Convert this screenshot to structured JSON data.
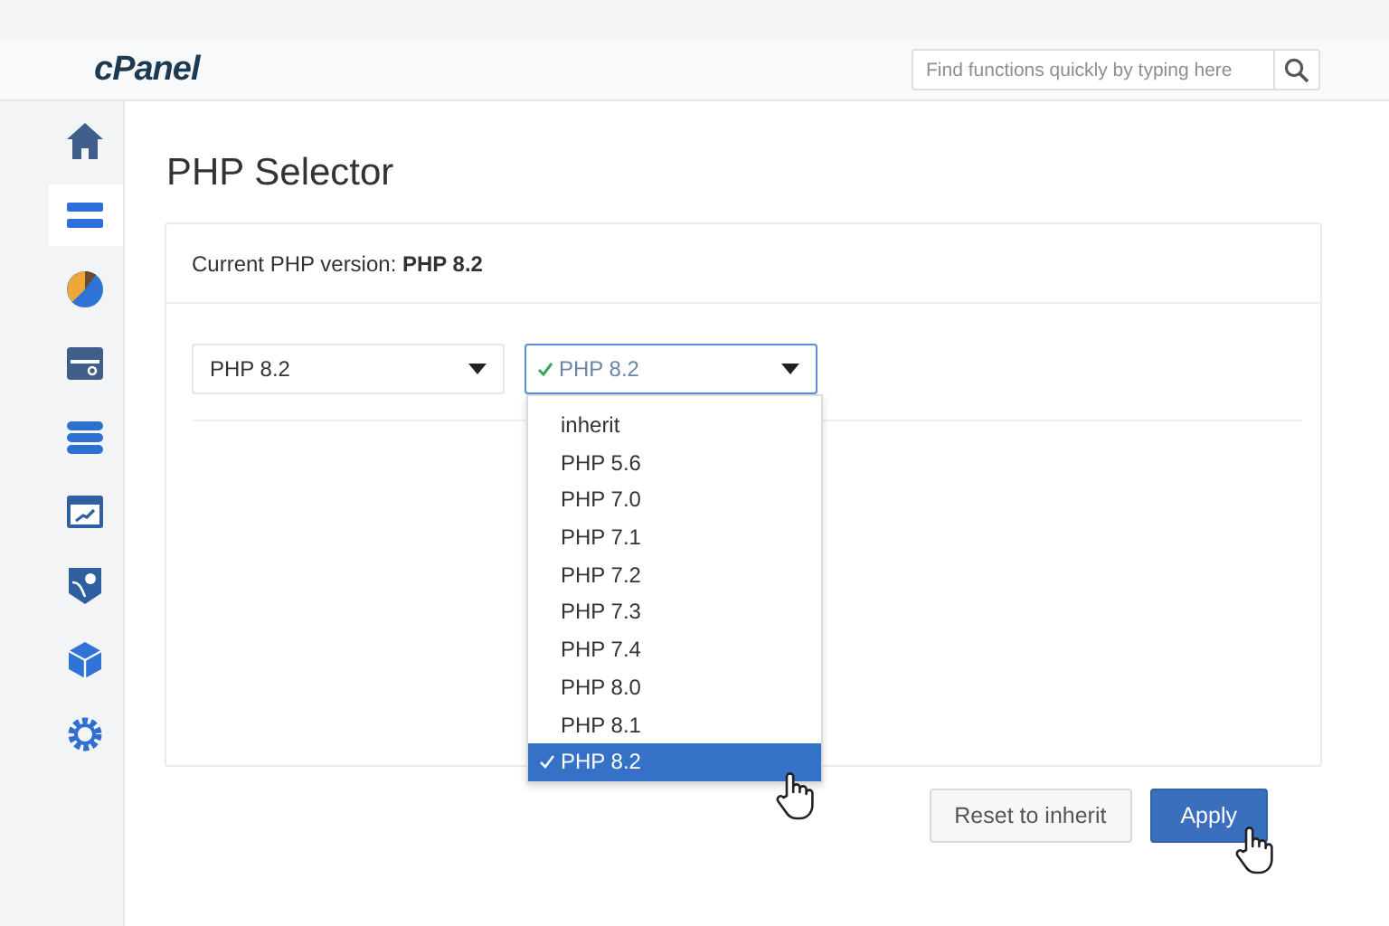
{
  "header": {
    "logo": "cPanel",
    "search": {
      "placeholder": "Find functions quickly by typing here"
    }
  },
  "sidebar": {
    "items": [
      {
        "kind": "home",
        "selected": false
      },
      {
        "kind": "menu",
        "selected": true
      },
      {
        "kind": "pie",
        "selected": false
      },
      {
        "kind": "server",
        "selected": false
      },
      {
        "kind": "database",
        "selected": false
      },
      {
        "kind": "chart",
        "selected": false
      },
      {
        "kind": "tag",
        "selected": false
      },
      {
        "kind": "cube",
        "selected": false
      },
      {
        "kind": "gear",
        "selected": false
      }
    ]
  },
  "page": {
    "title": "PHP Selector"
  },
  "current_version": "Current PHP version: **PHP 8.2**",
  "selects": [
    {
      "value": "PHP 8.2",
      "focused": false,
      "checked": false
    },
    {
      "value": "PHP 8.2",
      "focused": true,
      "checked": true
    }
  ],
  "dropdown": {
    "options": [
      {
        "label": "inherit",
        "selected": false
      },
      {
        "label": "PHP 5.6",
        "selected": false
      },
      {
        "label": "PHP 7.0",
        "selected": false
      },
      {
        "label": "PHP 7.1",
        "selected": false
      },
      {
        "label": "PHP 7.2",
        "selected": false
      },
      {
        "label": "PHP 7.3",
        "selected": false
      },
      {
        "label": "PHP 7.4",
        "selected": false
      },
      {
        "label": "PHP 8.0",
        "selected": false
      },
      {
        "label": "PHP 8.1",
        "selected": false
      },
      {
        "label": "PHP 8.2",
        "selected": true
      }
    ]
  },
  "buttons": [
    {
      "label": "Reset to inherit",
      "kind": "secondary"
    },
    {
      "label": "Apply",
      "kind": "primary"
    }
  ]
}
